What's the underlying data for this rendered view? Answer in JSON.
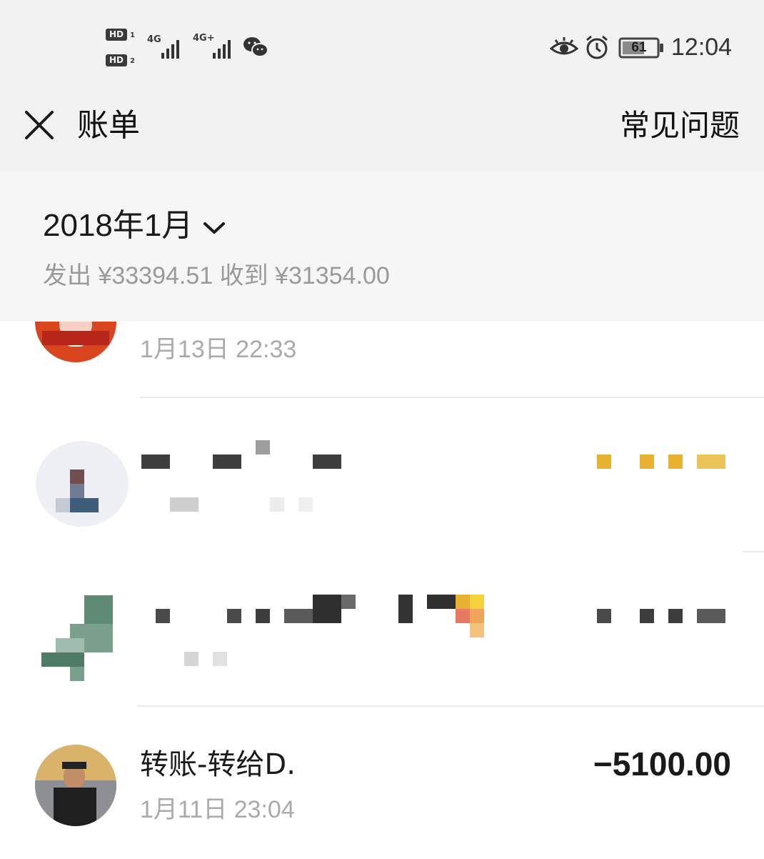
{
  "status_bar": {
    "hd1": "HD",
    "hd1_sub": "1",
    "hd2": "HD",
    "hd2_sub": "2",
    "net1": "4G",
    "net2": "4G+",
    "battery": "61",
    "time": "12:04",
    "icons": [
      "wechat-icon",
      "eye-icon",
      "alarm-icon",
      "battery-icon"
    ]
  },
  "header": {
    "title": "账单",
    "faq_label": "常见问题"
  },
  "summary": {
    "month": "2018年1月",
    "totals": "发出 ¥33394.51 收到 ¥31354.00"
  },
  "transactions": [
    {
      "title": "",
      "time": "1月13日 22:33",
      "amount": "",
      "blurred": false
    },
    {
      "title": "",
      "time": "",
      "amount": "",
      "blurred": true
    },
    {
      "title": "",
      "time": "",
      "amount": "",
      "blurred": true
    },
    {
      "title": "转账-转给D.",
      "time": "1月11日 23:04",
      "amount": "−5100.00",
      "blurred": false
    }
  ],
  "colors": {
    "header_bg": "#f2f2f2",
    "summary_bg": "#f6f6f6",
    "muted_text": "#9a9a9a",
    "blur_orange": "#e9b130"
  }
}
